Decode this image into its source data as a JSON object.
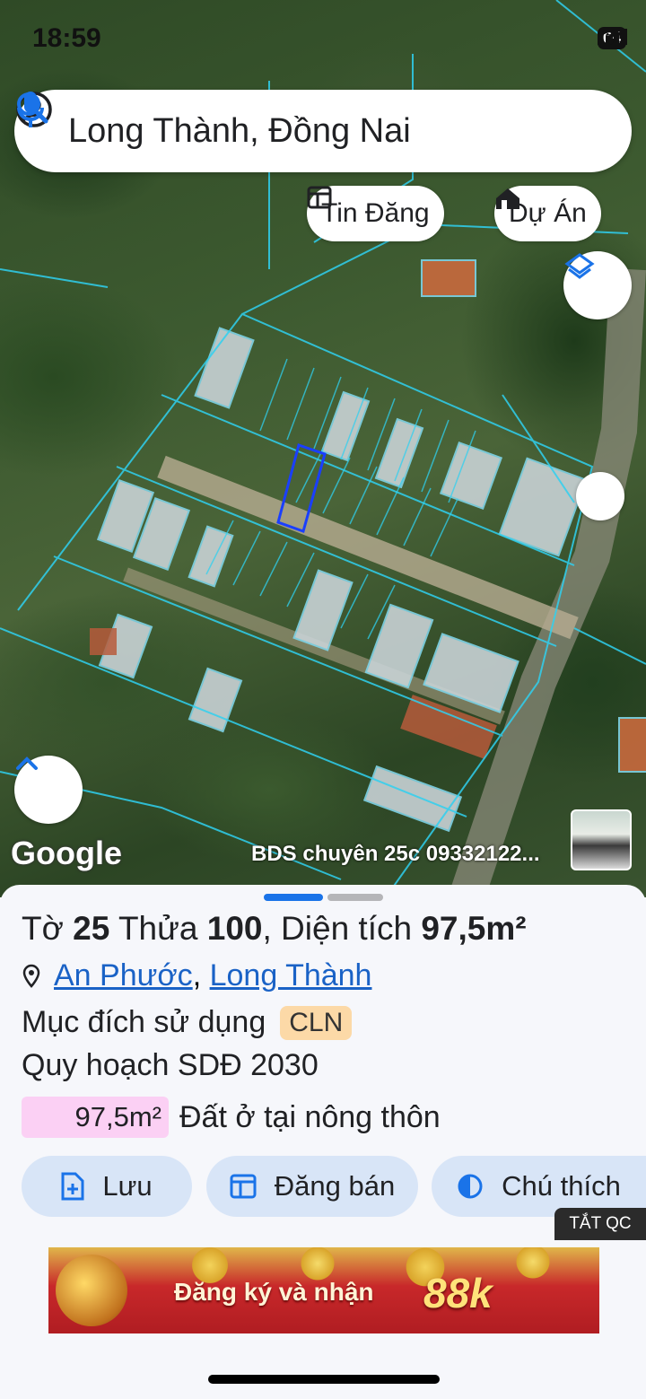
{
  "status_bar": {
    "time": "18:59",
    "battery": "64"
  },
  "search": {
    "text": "Long Thành, Đồng Nai"
  },
  "chips": {
    "listings": "Tin Đăng",
    "projects": "Dự Án"
  },
  "map": {
    "logo": "Google",
    "watermark": "BDS chuyên 25c 09332122..."
  },
  "parcel": {
    "sheet_prefix": "Tờ",
    "sheet_number": "25",
    "plot_prefix": "Thửa",
    "plot_number": "100",
    "area_label": "Diện tích",
    "area_value": "97,5m²",
    "ward": "An Phước",
    "district": "Long Thành",
    "purpose_label": "Mục đích sử dụng",
    "purpose_code": "CLN",
    "plan_label": "Quy hoạch SDĐ 2030",
    "plan_area": "97,5m²",
    "plan_type": "Đất ở tại nông thôn"
  },
  "actions": {
    "save": "Lưu",
    "sell": "Đăng bán",
    "legend": "Chú thích"
  },
  "ad": {
    "close_label": "TẮT QC",
    "text": "Đăng ký và nhận",
    "amount": "88k"
  },
  "colors": {
    "accent": "#1a73e8",
    "button_bg": "#d8e5f7",
    "purpose_badge": "#fcd9a7",
    "plan_badge": "#fbd0f4"
  }
}
